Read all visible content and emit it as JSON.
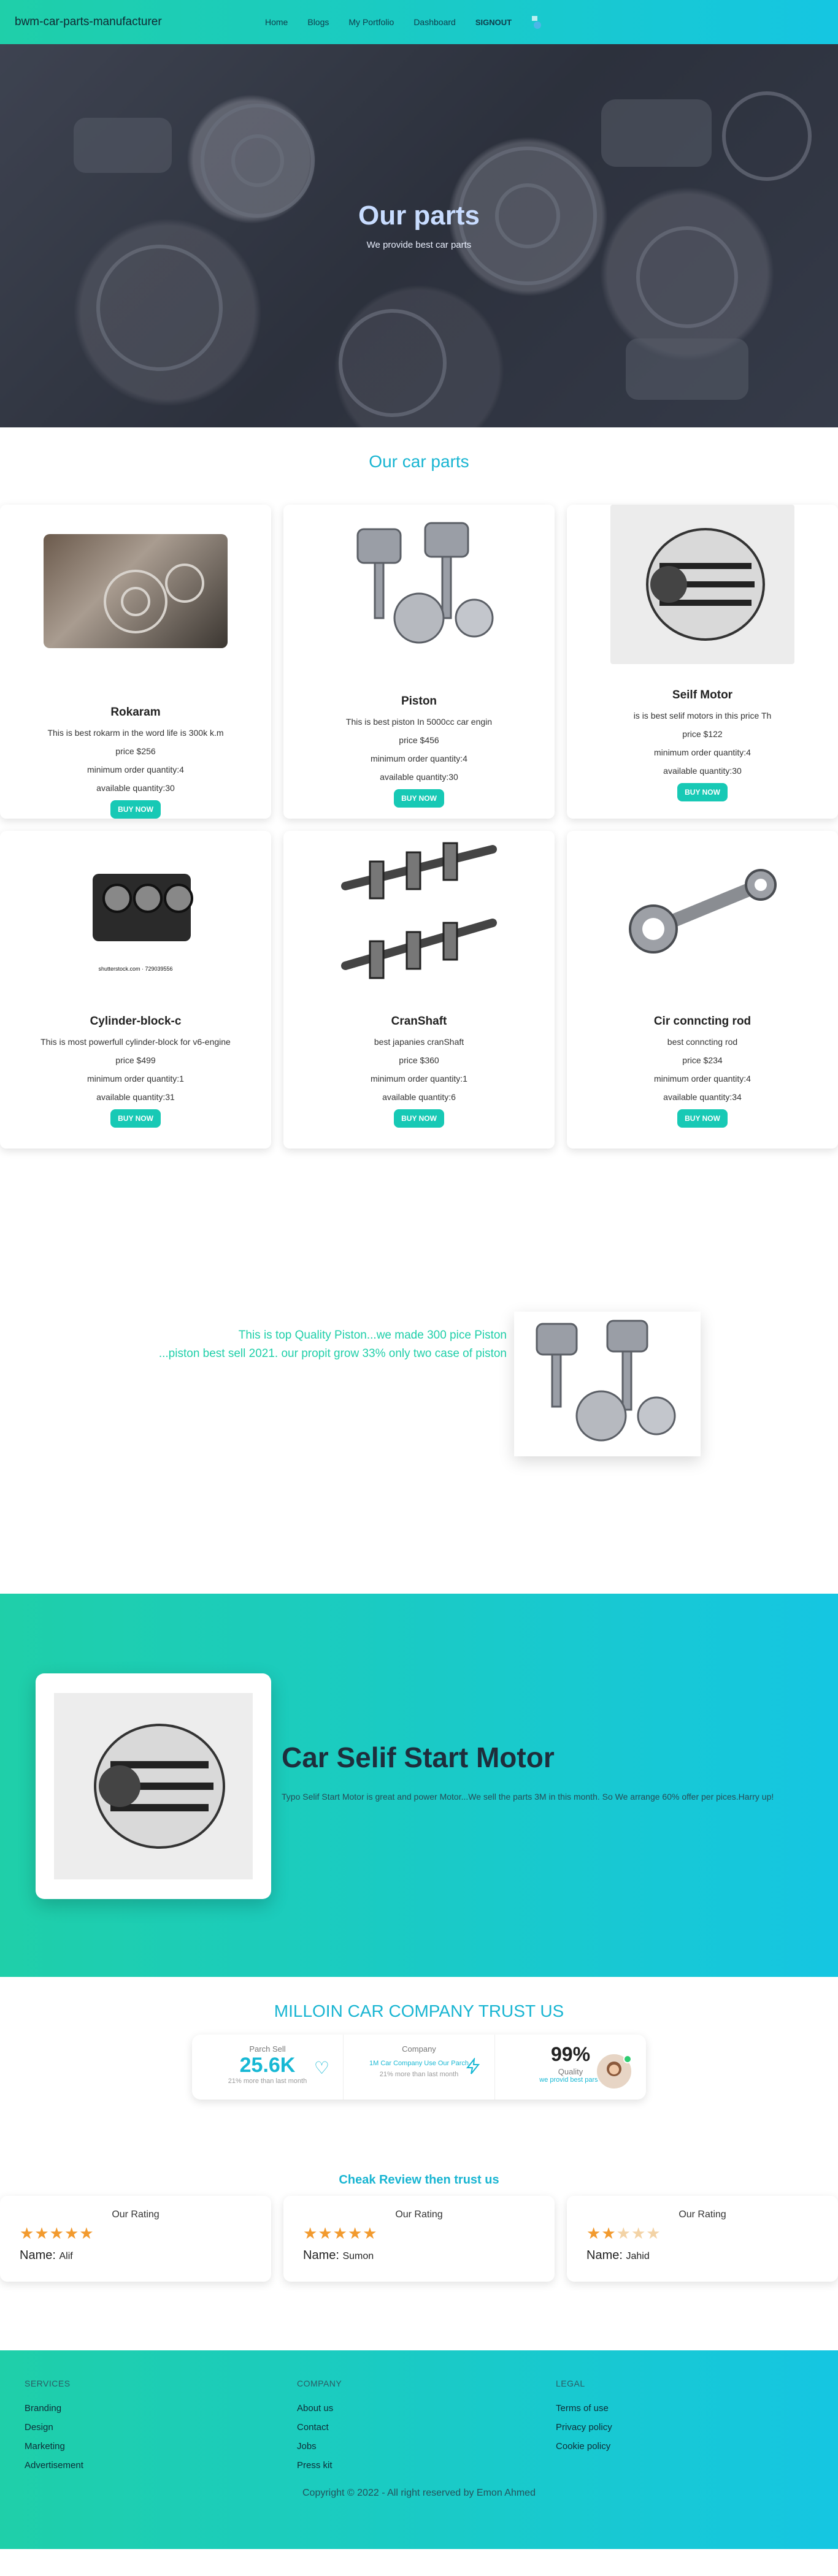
{
  "nav": {
    "brand": "bwm-car-parts-manufacturer",
    "links": [
      "Home",
      "Blogs",
      "My Portfolio",
      "Dashboard"
    ],
    "signout": "SIGNOUT"
  },
  "hero": {
    "title": "Our parts",
    "subtitle": "We provide best car parts"
  },
  "parts": {
    "title": "Our car parts",
    "buy_label": "BUY NOW",
    "items": [
      {
        "name": "Rokaram",
        "desc": "This is best rokarm in the word life is 300k k.m",
        "price": "price $256",
        "min": "minimum order quantity:4",
        "avail": "available quantity:30"
      },
      {
        "name": "Piston",
        "desc": "This is best piston In 5000cc car engin",
        "price": "price $456",
        "min": "minimum order quantity:4",
        "avail": "available quantity:30"
      },
      {
        "name": "Seilf Motor",
        "desc": "is is best selif motors in this price Th",
        "price": "price $122",
        "min": "minimum order quantity:4",
        "avail": "available quantity:30"
      },
      {
        "name": "Cylinder-block-c",
        "desc": "This is most powerfull cylinder-block for v6-engine",
        "price": "price $499",
        "min": "minimum order quantity:1",
        "avail": "available quantity:31"
      },
      {
        "name": "CranShaft",
        "desc": "best japanies cranShaft",
        "price": "price $360",
        "min": "minimum order quantity:1",
        "avail": "available quantity:6"
      },
      {
        "name": "Cir conncting rod",
        "desc": "best conncting rod",
        "price": "price $234",
        "min": "minimum order quantity:4",
        "avail": "available quantity:34"
      }
    ],
    "watermark": "shutterstock.com · 729039556"
  },
  "promo": {
    "line1": "This is top Quality Piston...we made 300 pice Piston",
    "line2": "...piston best sell 2021. our propit grow 33% only two case of piston"
  },
  "feature": {
    "title": "Car Selif Start Motor",
    "desc": "Typo Selif Start Motor is great and power Motor...We sell the parts 3M in this month. So We arrange 60% offer per pices.Harry up!"
  },
  "trust": {
    "title": "MILLOIN CAR COMPANY TRUST US",
    "stats": [
      {
        "title": "Parch Sell",
        "value": "25.6K",
        "desc": "21% more than last month"
      },
      {
        "title": "Company",
        "value": "1M Car Company Use Our Parch",
        "desc": "21% more than last month"
      },
      {
        "title": "Quality",
        "value": "99%",
        "desc": "we provid best parse"
      }
    ]
  },
  "reviews": {
    "title": "Cheak Review then trust us",
    "items": [
      {
        "heading": "Our Rating",
        "name_label": "Name:",
        "name": "Alif",
        "rating": 5
      },
      {
        "heading": "Our Rating",
        "name_label": "Name:",
        "name": "Sumon",
        "rating": 5
      },
      {
        "heading": "Our Rating",
        "name_label": "Name:",
        "name": "Jahid",
        "rating": 2
      }
    ]
  },
  "footer": {
    "services": {
      "title": "SERVICES",
      "links": [
        "Branding",
        "Design",
        "Marketing",
        "Advertisement"
      ]
    },
    "company": {
      "title": "COMPANY",
      "links": [
        "About us",
        "Contact",
        "Jobs",
        "Press kit"
      ]
    },
    "legal": {
      "title": "LEGAL",
      "links": [
        "Terms of use",
        "Privacy policy",
        "Cookie policy"
      ]
    },
    "copyright": "Copyright © 2022 - All right reserved by Emon Ahmed"
  },
  "colors": {
    "accent": "#17c9b5",
    "brand_gradient_start": "#1fcfa9",
    "brand_gradient_end": "#15c6e2",
    "star": "#f29a2e"
  }
}
